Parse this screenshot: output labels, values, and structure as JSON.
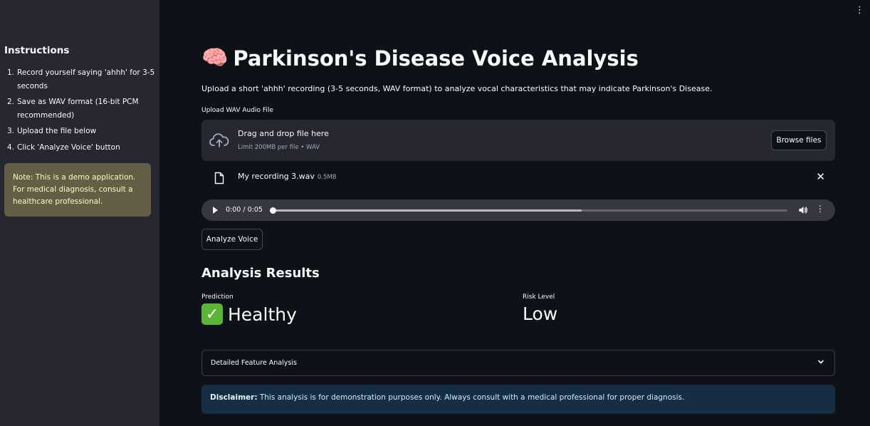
{
  "sidebar": {
    "heading": "Instructions",
    "steps": [
      {
        "num": "1.",
        "text": "Record yourself saying 'ahhh' for 3-5 seconds"
      },
      {
        "num": "2.",
        "text": "Save as WAV format (16-bit PCM recommended)"
      },
      {
        "num": "3.",
        "text": "Upload the file below"
      },
      {
        "num": "4.",
        "text": "Click 'Analyze Voice' button"
      }
    ],
    "note": "Note: This is a demo application. For medical diagnosis, consult a healthcare professional."
  },
  "header": {
    "menu_icon": "⋮"
  },
  "main": {
    "title_emoji": "🧠",
    "title": "Parkinson's Disease Voice Analysis",
    "subtitle": "Upload a short 'ahhh' recording (3-5 seconds, WAV format) to analyze vocal characteristics that may indicate Parkinson's Disease.",
    "uploader": {
      "label": "Upload WAV Audio File",
      "drop_title": "Drag and drop file here",
      "drop_limit": "Limit 200MB per file • WAV",
      "browse_label": "Browse files",
      "icon": "cloud-upload-icon"
    },
    "file": {
      "name": "My recording 3.wav",
      "size": "0.5MB",
      "close": "✕"
    },
    "audio": {
      "time": "0:00 / 0:05",
      "buffered_fraction": 0.6,
      "played_fraction": 0.0
    },
    "analyze_label": "Analyze Voice",
    "results": {
      "heading": "Analysis Results",
      "prediction_label": "Prediction",
      "prediction_value": "Healthy",
      "risk_label": "Risk Level",
      "risk_value": "Low"
    },
    "expander_label": "Detailed Feature Analysis",
    "disclaimer_bold": "Disclaimer:",
    "disclaimer_text": " This analysis is for demonstration purposes only. Always consult with a medical professional for proper diagnosis."
  },
  "colors": {
    "background": "#0e1117",
    "sidebar": "#262730",
    "note_bg": "#4d4a2a",
    "disclaimer_bg": "#172d43",
    "check_green": "#5bb637"
  }
}
